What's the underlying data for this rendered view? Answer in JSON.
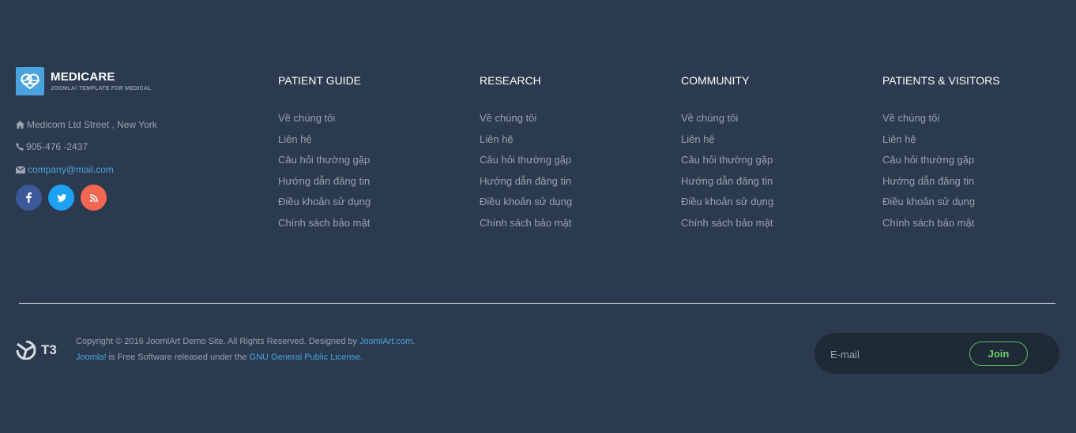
{
  "brand": {
    "name": "MEDICARE",
    "tagline": "JOOMLA! TEMPLATE FOR MEDICAL"
  },
  "contact": {
    "address": "Medicom Ltd Street , New York",
    "phone": "905-476 -2437",
    "email": "company@mail.com"
  },
  "social": {
    "facebook": "f",
    "twitter": "t",
    "rss": "rss"
  },
  "columns": [
    {
      "title": "PATIENT GUIDE",
      "links": [
        "Về chúng tôi",
        "Liên hệ",
        "Câu hỏi thường gặp",
        "Hướng dẫn đăng tin",
        "Điều khoản sử dụng",
        "Chính sách bảo mật"
      ]
    },
    {
      "title": "RESEARCH",
      "links": [
        "Về chúng tôi",
        "Liên hệ",
        "Câu hỏi thường gặp",
        "Hướng dẫn đăng tin",
        "Điều khoản sử dụng",
        "Chính sách bảo mật"
      ]
    },
    {
      "title": "COMMUNITY",
      "links": [
        "Về chúng tôi",
        "Liên hệ",
        "Câu hỏi thường gặp",
        "Hướng dẫn đăng tin",
        "Điều khoản sử dụng",
        "Chính sách bảo mật"
      ]
    },
    {
      "title": "PATIENTS & VISITORS",
      "links": [
        "Về chúng tôi",
        "Liên hệ",
        "Câu hỏi thường gặp",
        "Hướng dẫn đăng tin",
        "Điều khoản sử dụng",
        "Chính sách bảo mật"
      ]
    }
  ],
  "footer": {
    "t3_label": "T3",
    "copyright_prefix": "Copyright © 2016 JoomlArt Demo Site. All Rights Reserved. Designed by ",
    "designer_link": "JoomlArt.com",
    "copyright_suffix": ".",
    "joomla_link": "Joomla!",
    "license_text": " is Free Software released under the ",
    "license_link": "GNU General Public License",
    "license_suffix": "."
  },
  "newsletter": {
    "placeholder": "E-mail",
    "button_label": "Join"
  },
  "colors": {
    "background": "#2b3a4e",
    "accent": "#4aa3df",
    "join_green": "#5cb85c"
  }
}
